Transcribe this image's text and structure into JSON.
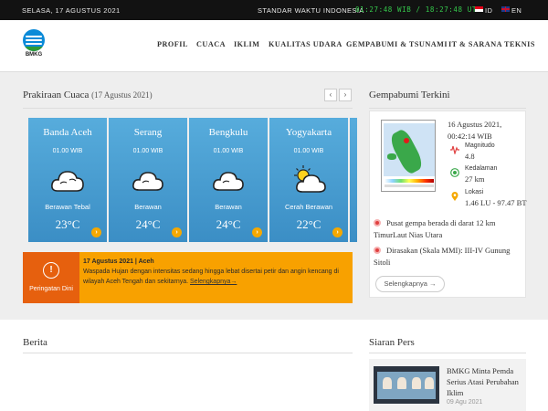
{
  "topbar": {
    "date": "SELASA, 17 AGUSTUS 2021",
    "standard_time_label": "STANDAR WAKTU INDONESIA",
    "clock": "01:27:48 WIB / 18:27:48 UTC",
    "languages": [
      "ID",
      "EN"
    ]
  },
  "brand": {
    "logo_text": "BMKG",
    "accent_color": "#f8a100",
    "warning_color": "#e6600e",
    "card_color": "#4b9fd2"
  },
  "nav": [
    "PROFIL",
    "CUACA",
    "IKLIM",
    "KUALITAS UDARA",
    "GEMPABUMI & TSUNAMI",
    "IT & SARANA TEKNIS"
  ],
  "forecast": {
    "title": "Prakiraan Cuaca",
    "date": "(17 Agustus 2021)",
    "prev_icon": "chevron-left-icon",
    "next_icon": "chevron-right-icon",
    "cards": [
      {
        "city": "Banda Aceh",
        "time": "01.00 WIB",
        "icon": "heavy-cloud-icon",
        "condition": "Berawan Tebal",
        "temp": "23°C"
      },
      {
        "city": "Serang",
        "time": "01.00 WIB",
        "icon": "cloud-icon",
        "condition": "Berawan",
        "temp": "24°C"
      },
      {
        "city": "Bengkulu",
        "time": "01.00 WIB",
        "icon": "cloud-icon",
        "condition": "Berawan",
        "temp": "24°C"
      },
      {
        "city": "Yogyakarta",
        "time": "01.00 WIB",
        "icon": "partly-cloudy-icon",
        "condition": "Cerah Berawan",
        "temp": "22°C"
      }
    ]
  },
  "warning": {
    "label": "Peringatan Dini",
    "icon": "warning-icon",
    "headline": "17 Agustus 2021 | Aceh",
    "text": "Waspada Hujan dengan intensitas sedang hingga lebat disertai petir dan angin kencang di wilayah Aceh Tengah dan sekitarnya.",
    "more": "Selengkapnya→"
  },
  "earthquake": {
    "title": "Gempabumi Terkini",
    "datetime": "16 Agustus 2021, 00:42:14 WIB",
    "magnitude_label": "Magnitudo",
    "magnitude": "4.8",
    "depth_label": "Kedalaman",
    "depth": "27 km",
    "location_label": "Lokasi",
    "location": "1.46 LU - 97.47 BT",
    "epicenter": "Pusat gempa berada di darat 12 km TimurLaut Nias Utara",
    "felt": "Dirasakan (Skala MMI): III-IV Gunung Sitoli",
    "more": "Selengkapnya →"
  },
  "news": {
    "title": "Berita"
  },
  "press": {
    "title": "Siaran Pers",
    "items": [
      {
        "title": "BMKG Minta Pemda Serius Atasi Perubahan Iklim",
        "date": "09 Agu 2021"
      }
    ]
  }
}
